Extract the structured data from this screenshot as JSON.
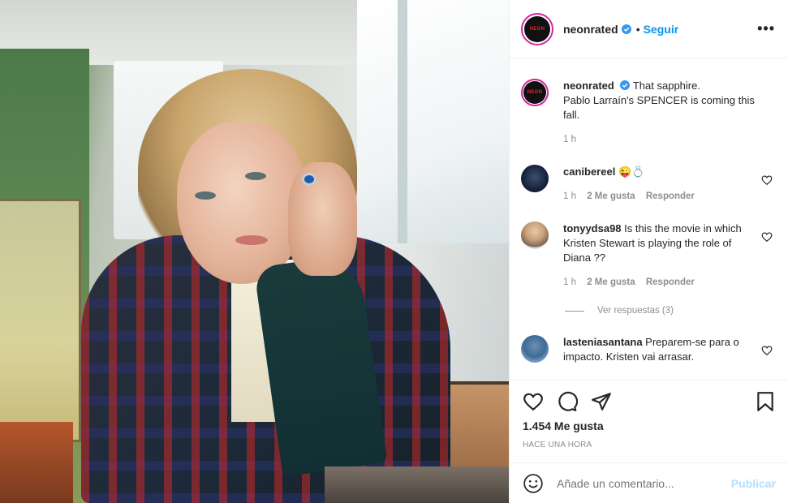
{
  "post": {
    "photo_alt": "Kristen Stewart as Diana in Spencer",
    "header": {
      "username": "neonrated",
      "separator": "•",
      "follow_label": "Seguir",
      "more_label": "•••",
      "avatar_text": "NEON"
    },
    "caption": {
      "username": "neonrated",
      "text_line1": "That sapphire.",
      "text_line2": "Pablo Larraín's SPENCER is coming this fall.",
      "time": "1 h"
    },
    "comments": [
      {
        "username": "canibereel",
        "text": "😜💍",
        "time": "1 h",
        "likes": "2 Me gusta",
        "reply": "Responder"
      },
      {
        "username": "tonyydsa98",
        "text": "Is this the movie in which Kristen Stewart is playing the role of Diana ??",
        "time": "1 h",
        "likes": "2 Me gusta",
        "reply": "Responder",
        "view_replies": "Ver respuestas (3)"
      },
      {
        "username": "lasteniasantana",
        "text": "Preparem-se para o impacto. Kristen vai arrasar."
      }
    ],
    "likes_count": "1.454 Me gusta",
    "posted_time": "HACE UNA HORA",
    "add_comment": {
      "placeholder": "Añade un comentario...",
      "publish_label": "Publicar"
    },
    "colors": {
      "accent": "#0095f6",
      "publish_disabled": "#b2dffc",
      "muted": "#8e8e8e",
      "text": "#262626"
    }
  }
}
